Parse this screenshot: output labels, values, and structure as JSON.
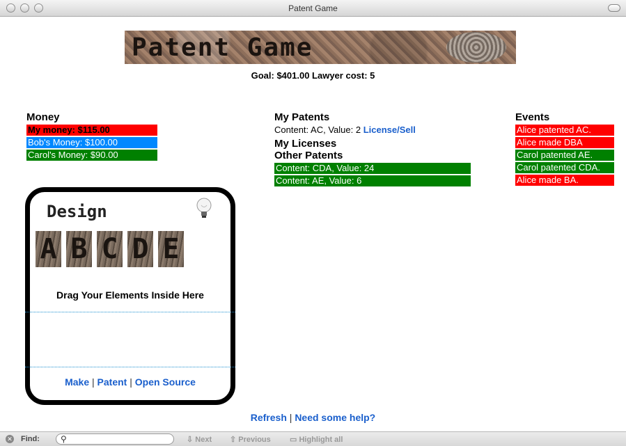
{
  "window": {
    "title": "Patent Game"
  },
  "banner": {
    "title": "Patent Game"
  },
  "goal_line": "Goal: $401.00 Lawyer cost: 5",
  "money": {
    "heading": "Money",
    "items": [
      {
        "label": "My money: $115.00",
        "color": "#ff0000"
      },
      {
        "label": "Bob's Money: $100.00",
        "color": "#0088ff"
      },
      {
        "label": "Carol's Money: $90.00",
        "color": "#008000"
      }
    ]
  },
  "patents": {
    "heading": "My Patents",
    "my_patent_text": "Content: AC, Value: 2",
    "license_link": "License/Sell",
    "licenses_heading": "My Licenses",
    "other_heading": "Other Patents",
    "other": [
      {
        "label": "Content: CDA, Value: 24",
        "color": "#008000"
      },
      {
        "label": "Content: AE, Value: 6",
        "color": "#008000"
      }
    ]
  },
  "events": {
    "heading": "Events",
    "items": [
      {
        "label": "Alice patented AC.",
        "color": "#ff0000"
      },
      {
        "label": "Alice made DBA",
        "color": "#ff0000"
      },
      {
        "label": "Carol patented AE.",
        "color": "#008000"
      },
      {
        "label": "Carol patented CDA.",
        "color": "#008000"
      },
      {
        "label": "Alice made BA.",
        "color": "#ff0000"
      }
    ]
  },
  "design": {
    "title": "Design",
    "letters": [
      "A",
      "B",
      "C",
      "D",
      "E"
    ],
    "drag_text": "Drag Your Elements Inside Here",
    "make": "Make",
    "patent": "Patent",
    "open_source": "Open Source",
    "sep": "|"
  },
  "bottom": {
    "refresh": "Refresh",
    "help": "Need some help?",
    "sep": "|"
  },
  "findbar": {
    "label": "Find:",
    "next": "Next",
    "previous": "Previous",
    "highlight": "Highlight all"
  }
}
